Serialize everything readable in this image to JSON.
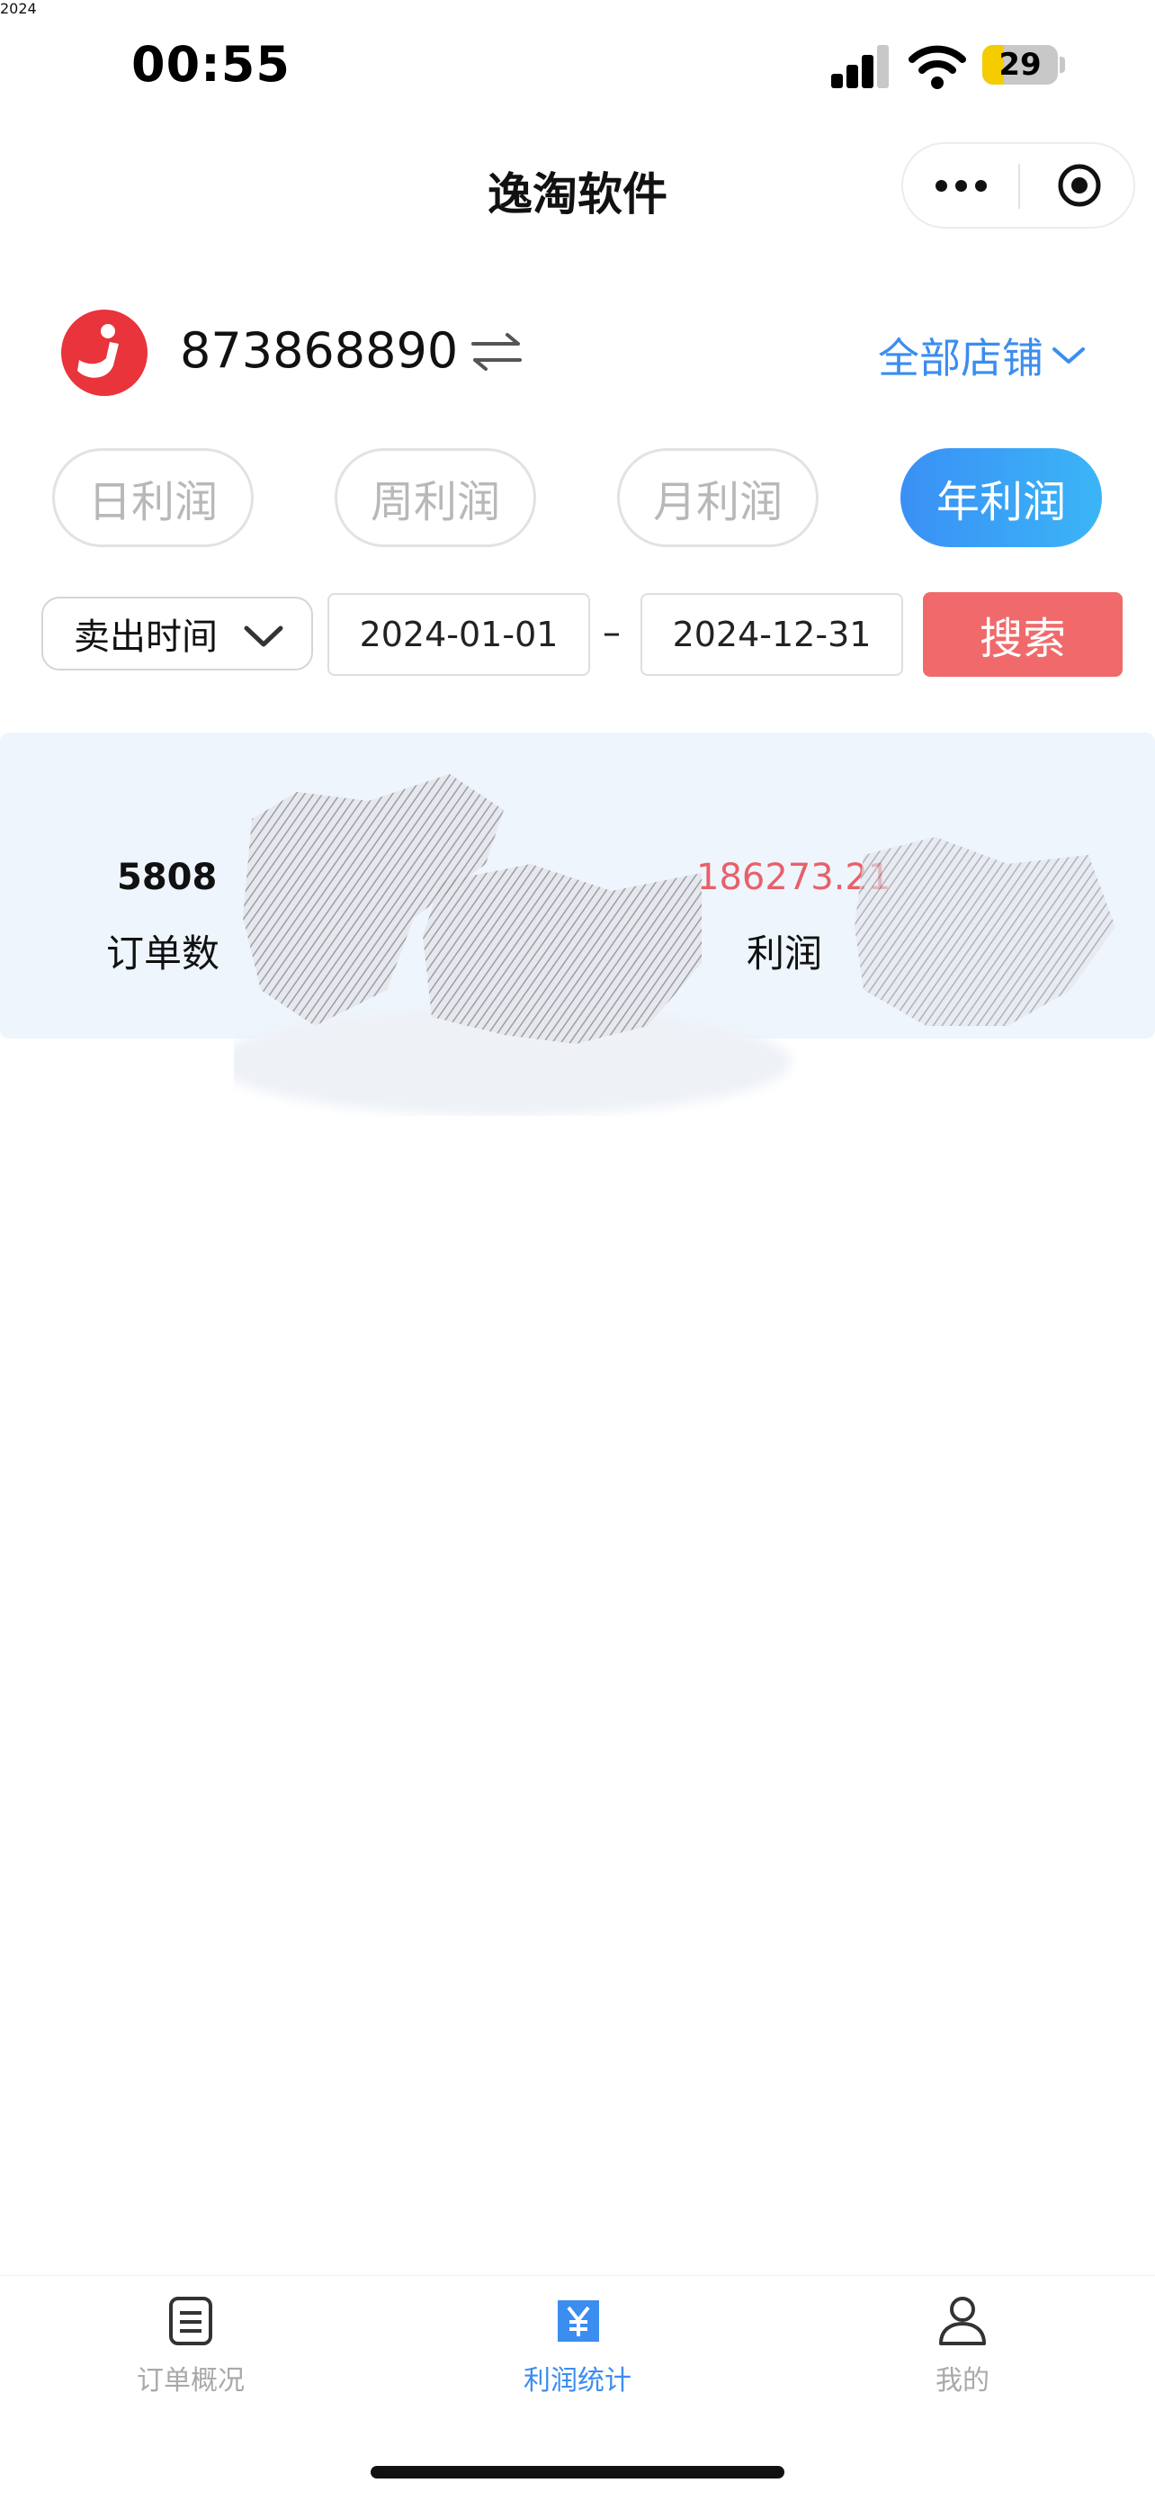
{
  "status_bar": {
    "time": "00:55",
    "battery": "29",
    "battery_level": 0.29
  },
  "nav": {
    "title": "逸淘软件"
  },
  "account": {
    "id": "873868890",
    "shop_filter": "全部店铺"
  },
  "tabs": [
    {
      "label": "日利润",
      "active": false
    },
    {
      "label": "周利润",
      "active": false
    },
    {
      "label": "月利润",
      "active": false
    },
    {
      "label": "年利润",
      "active": true
    }
  ],
  "filter": {
    "time_type": "卖出时间",
    "start_date": "2024-01-01",
    "separator": "–",
    "end_date": "2024-12-31",
    "search_label": "搜索"
  },
  "result": {
    "year": "2024",
    "orders_value": "5808",
    "orders_label": "订单数",
    "profit_value": "186273.21",
    "profit_label": "利润"
  },
  "bottom_tabs": [
    {
      "label": "订单概况",
      "icon": "clipboard-icon",
      "active": false
    },
    {
      "label": "利润统计",
      "icon": "yen-icon",
      "active": true
    },
    {
      "label": "我的",
      "icon": "person-icon",
      "active": false
    }
  ],
  "colors": {
    "accent": "#3b8df0",
    "search": "#f06a6b",
    "profit": "#e8606a",
    "card_bg": "#eef5fd"
  }
}
